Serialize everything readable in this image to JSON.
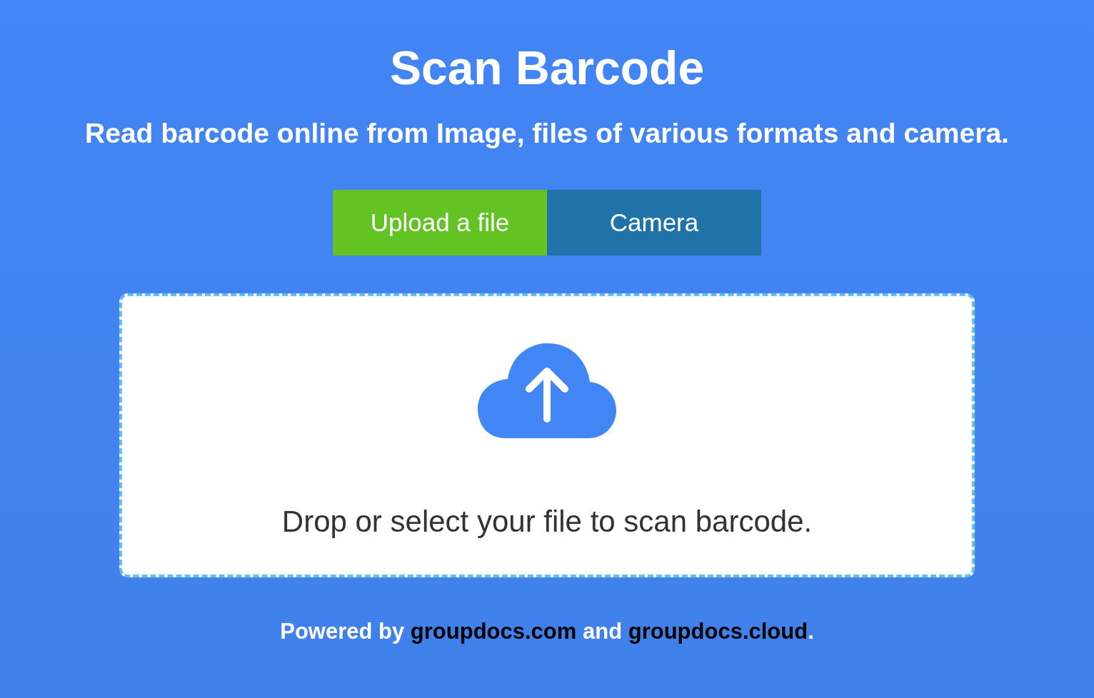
{
  "title": "Scan Barcode",
  "subtitle": "Read barcode online from Image, files of various formats and camera.",
  "tabs": [
    {
      "label": "Upload a file",
      "selected": true
    },
    {
      "label": "Camera",
      "selected": false
    }
  ],
  "dropzone": {
    "text": "Drop or select your file to scan barcode."
  },
  "footer": {
    "prefix": "Powered by",
    "links": [
      "groupdocs.com",
      "groupdocs.cloud"
    ],
    "joiner": "and",
    "suffix": "."
  }
}
